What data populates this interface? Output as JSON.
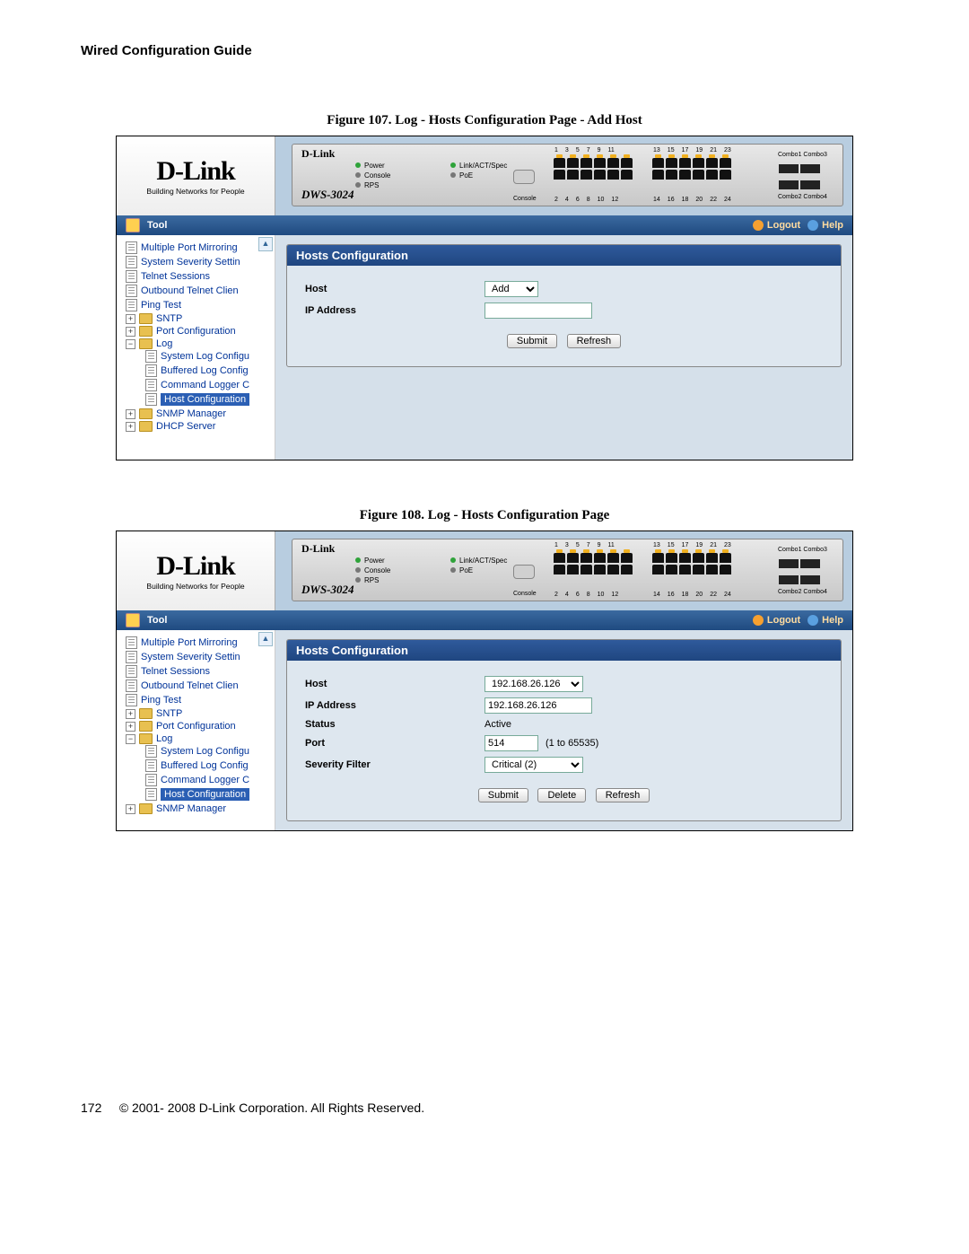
{
  "doc": {
    "header": "Wired Configuration Guide",
    "page_number": "172",
    "copyright": "© 2001- 2008 D-Link Corporation. All Rights Reserved."
  },
  "figure107": {
    "caption_prefix": "Figure 107. ",
    "caption_text": "Log - Hosts Configuration Page - Add Host"
  },
  "figure108": {
    "caption_prefix": "Figure 108. ",
    "caption_text": "Log - Hosts Configuration Page"
  },
  "logo": {
    "brand": "D-Link",
    "tagline": "Building Networks for People"
  },
  "device": {
    "model": "DWS-3024",
    "brand_short": "D-Link",
    "led1": "Power",
    "led2": "Console",
    "led3": "RPS",
    "led4": "Link/ACT/Spec",
    "led5": "PoE",
    "console": "Console",
    "combo_t": "Combo1 Combo3",
    "combo_b": "Combo2 Combo4",
    "ports_top1": "1",
    "ports_top3": "3",
    "ports_top5": "5",
    "ports_top7": "7",
    "ports_top9": "9",
    "ports_top11": "11",
    "ports_top13": "13",
    "ports_top15": "15",
    "ports_top17": "17",
    "ports_top19": "19",
    "ports_top21": "21",
    "ports_top23": "23",
    "ports_bot2": "2",
    "ports_bot4": "4",
    "ports_bot6": "6",
    "ports_bot8": "8",
    "ports_bot10": "10",
    "ports_bot12": "12",
    "ports_bot14": "14",
    "ports_bot16": "16",
    "ports_bot18": "18",
    "ports_bot20": "20",
    "ports_bot22": "22",
    "ports_bot24": "24"
  },
  "bluebar": {
    "tool": "Tool",
    "logout": "Logout",
    "help": "Help"
  },
  "tree": {
    "t0": "Multiple Port Mirroring",
    "t1": "System Severity Settin",
    "t2": "Telnet Sessions",
    "t3": "Outbound Telnet Clien",
    "t4": "Ping Test",
    "t5": "SNTP",
    "t6": "Port Configuration",
    "t7": "Log",
    "t7a": "System Log Configu",
    "t7b": "Buffered Log Config",
    "t7c": "Command Logger C",
    "t7d": "Host Configuration",
    "t8": "SNMP Manager",
    "t9": "DHCP Server"
  },
  "panel": {
    "title": "Hosts Configuration",
    "host_label": "Host",
    "ip_label": "IP Address",
    "status_label": "Status",
    "port_label": "Port",
    "severity_label": "Severity Filter",
    "port_range": "(1 to 65535)",
    "add_opt": "Add",
    "host_opt": "192.168.26.126",
    "ip_value": "192.168.26.126",
    "status_value": "Active",
    "port_value": "514",
    "sev_opt": "Critical (2)",
    "btn_submit": "Submit",
    "btn_refresh": "Refresh",
    "btn_delete": "Delete"
  }
}
